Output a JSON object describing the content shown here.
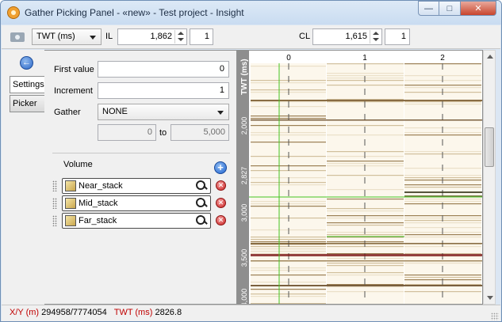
{
  "window": {
    "title": "Gather Picking Panel - «new» - Test project - Insight",
    "minimize": "—",
    "maximize": "□",
    "close": "✕"
  },
  "toolbar": {
    "domain_value": "TWT (ms)",
    "il_label": "IL",
    "il_value": "1,862",
    "il_step": "1",
    "cl_label": "CL",
    "cl_value": "1,615",
    "cl_step": "1"
  },
  "tabs": [
    "Settings",
    "Picker"
  ],
  "settings": {
    "first_value_label": "First value",
    "first_value": "0",
    "increment_label": "Increment",
    "increment": "1",
    "gather_label": "Gather",
    "gather_value": "NONE",
    "range_from": "0",
    "range_to_label": "to",
    "range_to": "5,000",
    "volume_label": "Volume",
    "volumes": [
      "Near_stack",
      "Mid_stack",
      "Far_stack"
    ]
  },
  "plot": {
    "axis_title": "TWT (ms)",
    "x_ticks": [
      "0",
      "1",
      "2"
    ],
    "y_ticks": [
      "2,000",
      "2,827",
      "3,000",
      "3,500",
      "4,000"
    ],
    "colors": {
      "cursor": "#43c51f",
      "strong_event": "#7a1414",
      "background": "#fcf7ec"
    }
  },
  "status": {
    "xy_label": "X/Y (m)",
    "xy_value": "294958/7774054",
    "twt_label": "TWT (ms)",
    "twt_value": "2826.8"
  },
  "icons": {
    "app": "gear-app-icon",
    "camera": "camera-icon",
    "back": "back-arrow-icon",
    "add": "add-icon",
    "search": "magnifier-icon",
    "remove": "remove-icon"
  }
}
